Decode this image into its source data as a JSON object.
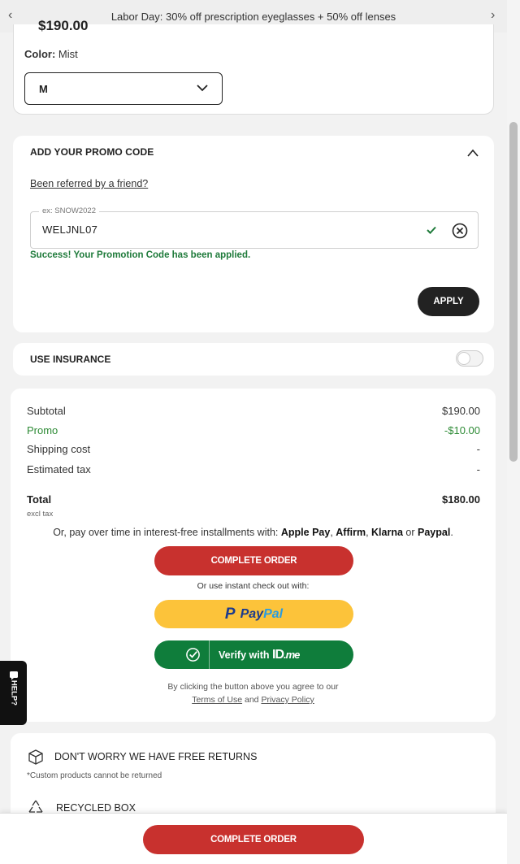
{
  "banner": {
    "text": "Labor Day: 30% off prescription eyeglasses + 50% off lenses"
  },
  "product": {
    "price_partial": "$190.00",
    "color_label": "Color:",
    "color_value": "Mist",
    "size_value": "M"
  },
  "promo": {
    "title": "ADD YOUR PROMO CODE",
    "referred_link": "Been referred by a friend?",
    "field_legend": "ex: SNOW2022",
    "field_value": "WELJNL07",
    "success": "Success! Your Promotion Code has been applied.",
    "apply_label": "APPLY"
  },
  "insurance": {
    "title": "USE INSURANCE",
    "enabled": false
  },
  "summary": {
    "rows": [
      {
        "label": "Subtotal",
        "value": "$190.00"
      },
      {
        "label": "Promo",
        "value": "-$10.00"
      },
      {
        "label": "Shipping cost",
        "value": "-"
      },
      {
        "label": "Estimated tax",
        "value": "-"
      }
    ],
    "total_label": "Total",
    "total_value": "$180.00",
    "excl_tax": "excl tax",
    "installments_prefix": "Or, pay over time in interest-free installments with:",
    "providers": [
      "Apple Pay",
      "Affirm",
      "Klarna",
      "Paypal"
    ],
    "complete_label": "COMPLETE ORDER",
    "instant_checkout": "Or use instant check out with:",
    "paypal_a": "Pay",
    "paypal_b": "Pal",
    "idme_text": "Verify with",
    "idme_logo_a": "ID",
    "idme_logo_b": ".me",
    "legal_prefix": "By clicking the button above you agree to our",
    "terms_link": "Terms of Use",
    "and_text": "and",
    "privacy_link": "Privacy Policy"
  },
  "returns": {
    "title": "DON'T WORRY WE HAVE FREE RETURNS",
    "note": "*Custom products cannot be returned",
    "recycled": "RECYCLED BOX"
  },
  "sticky": {
    "complete_label": "COMPLETE ORDER"
  },
  "help": {
    "label": "HELP?"
  },
  "colors": {
    "accent_red": "#c8312e",
    "success_green": "#1e7a3a",
    "paypal_yellow": "#fcc33a",
    "idme_green": "#0f7d3b"
  }
}
